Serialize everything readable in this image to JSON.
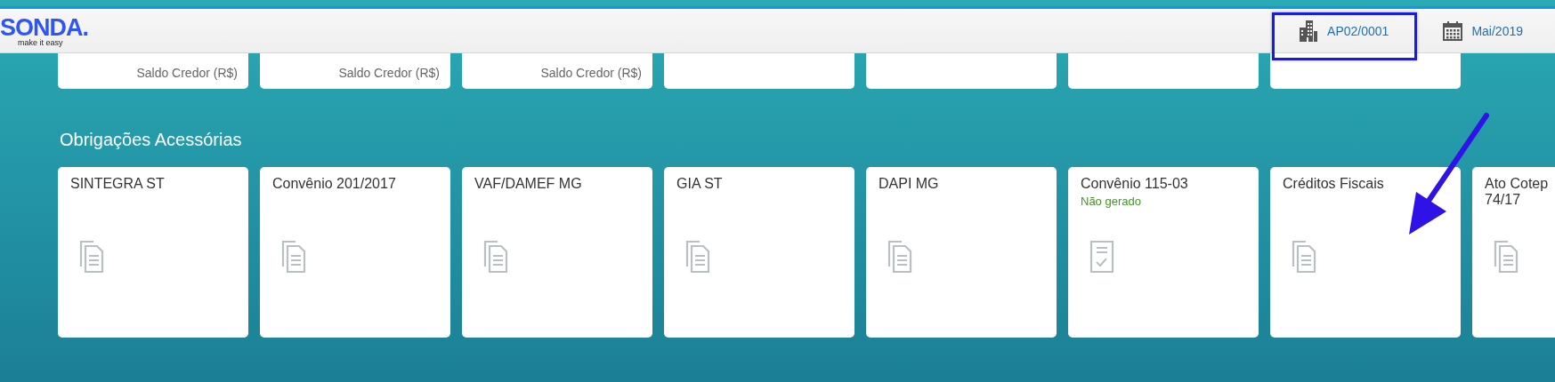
{
  "header": {
    "logo": {
      "name": "SONDA.",
      "tagline": "make it easy"
    },
    "company": {
      "label": "AP02/0001",
      "highlighted": true
    },
    "period": {
      "label": "Mai/2019"
    }
  },
  "balance_tiles": [
    {
      "kind": "balance",
      "caption": "Saldo Credor (R$)"
    },
    {
      "kind": "balance",
      "caption": "Saldo Credor (R$)"
    },
    {
      "kind": "balance",
      "caption": "Saldo Credor (R$)"
    },
    {
      "kind": "blank"
    },
    {
      "kind": "blank"
    },
    {
      "kind": "blank"
    },
    {
      "kind": "blank"
    }
  ],
  "section": {
    "title": "Obrigações Acessórias",
    "tiles": [
      {
        "title": "SINTEGRA ST",
        "kind": "documents"
      },
      {
        "title": "Convênio 201/2017",
        "kind": "documents"
      },
      {
        "title": "VAF/DAMEF MG",
        "kind": "documents"
      },
      {
        "title": "GIA ST",
        "kind": "documents"
      },
      {
        "title": "DAPI MG",
        "kind": "documents"
      },
      {
        "title": "Convênio 115-03",
        "kind": "checked",
        "status": "Não gerado"
      },
      {
        "title": "Créditos Fiscais",
        "kind": "documents",
        "pointed": true
      },
      {
        "title": "Ato Cotep 74/17",
        "kind": "documents"
      }
    ]
  }
}
